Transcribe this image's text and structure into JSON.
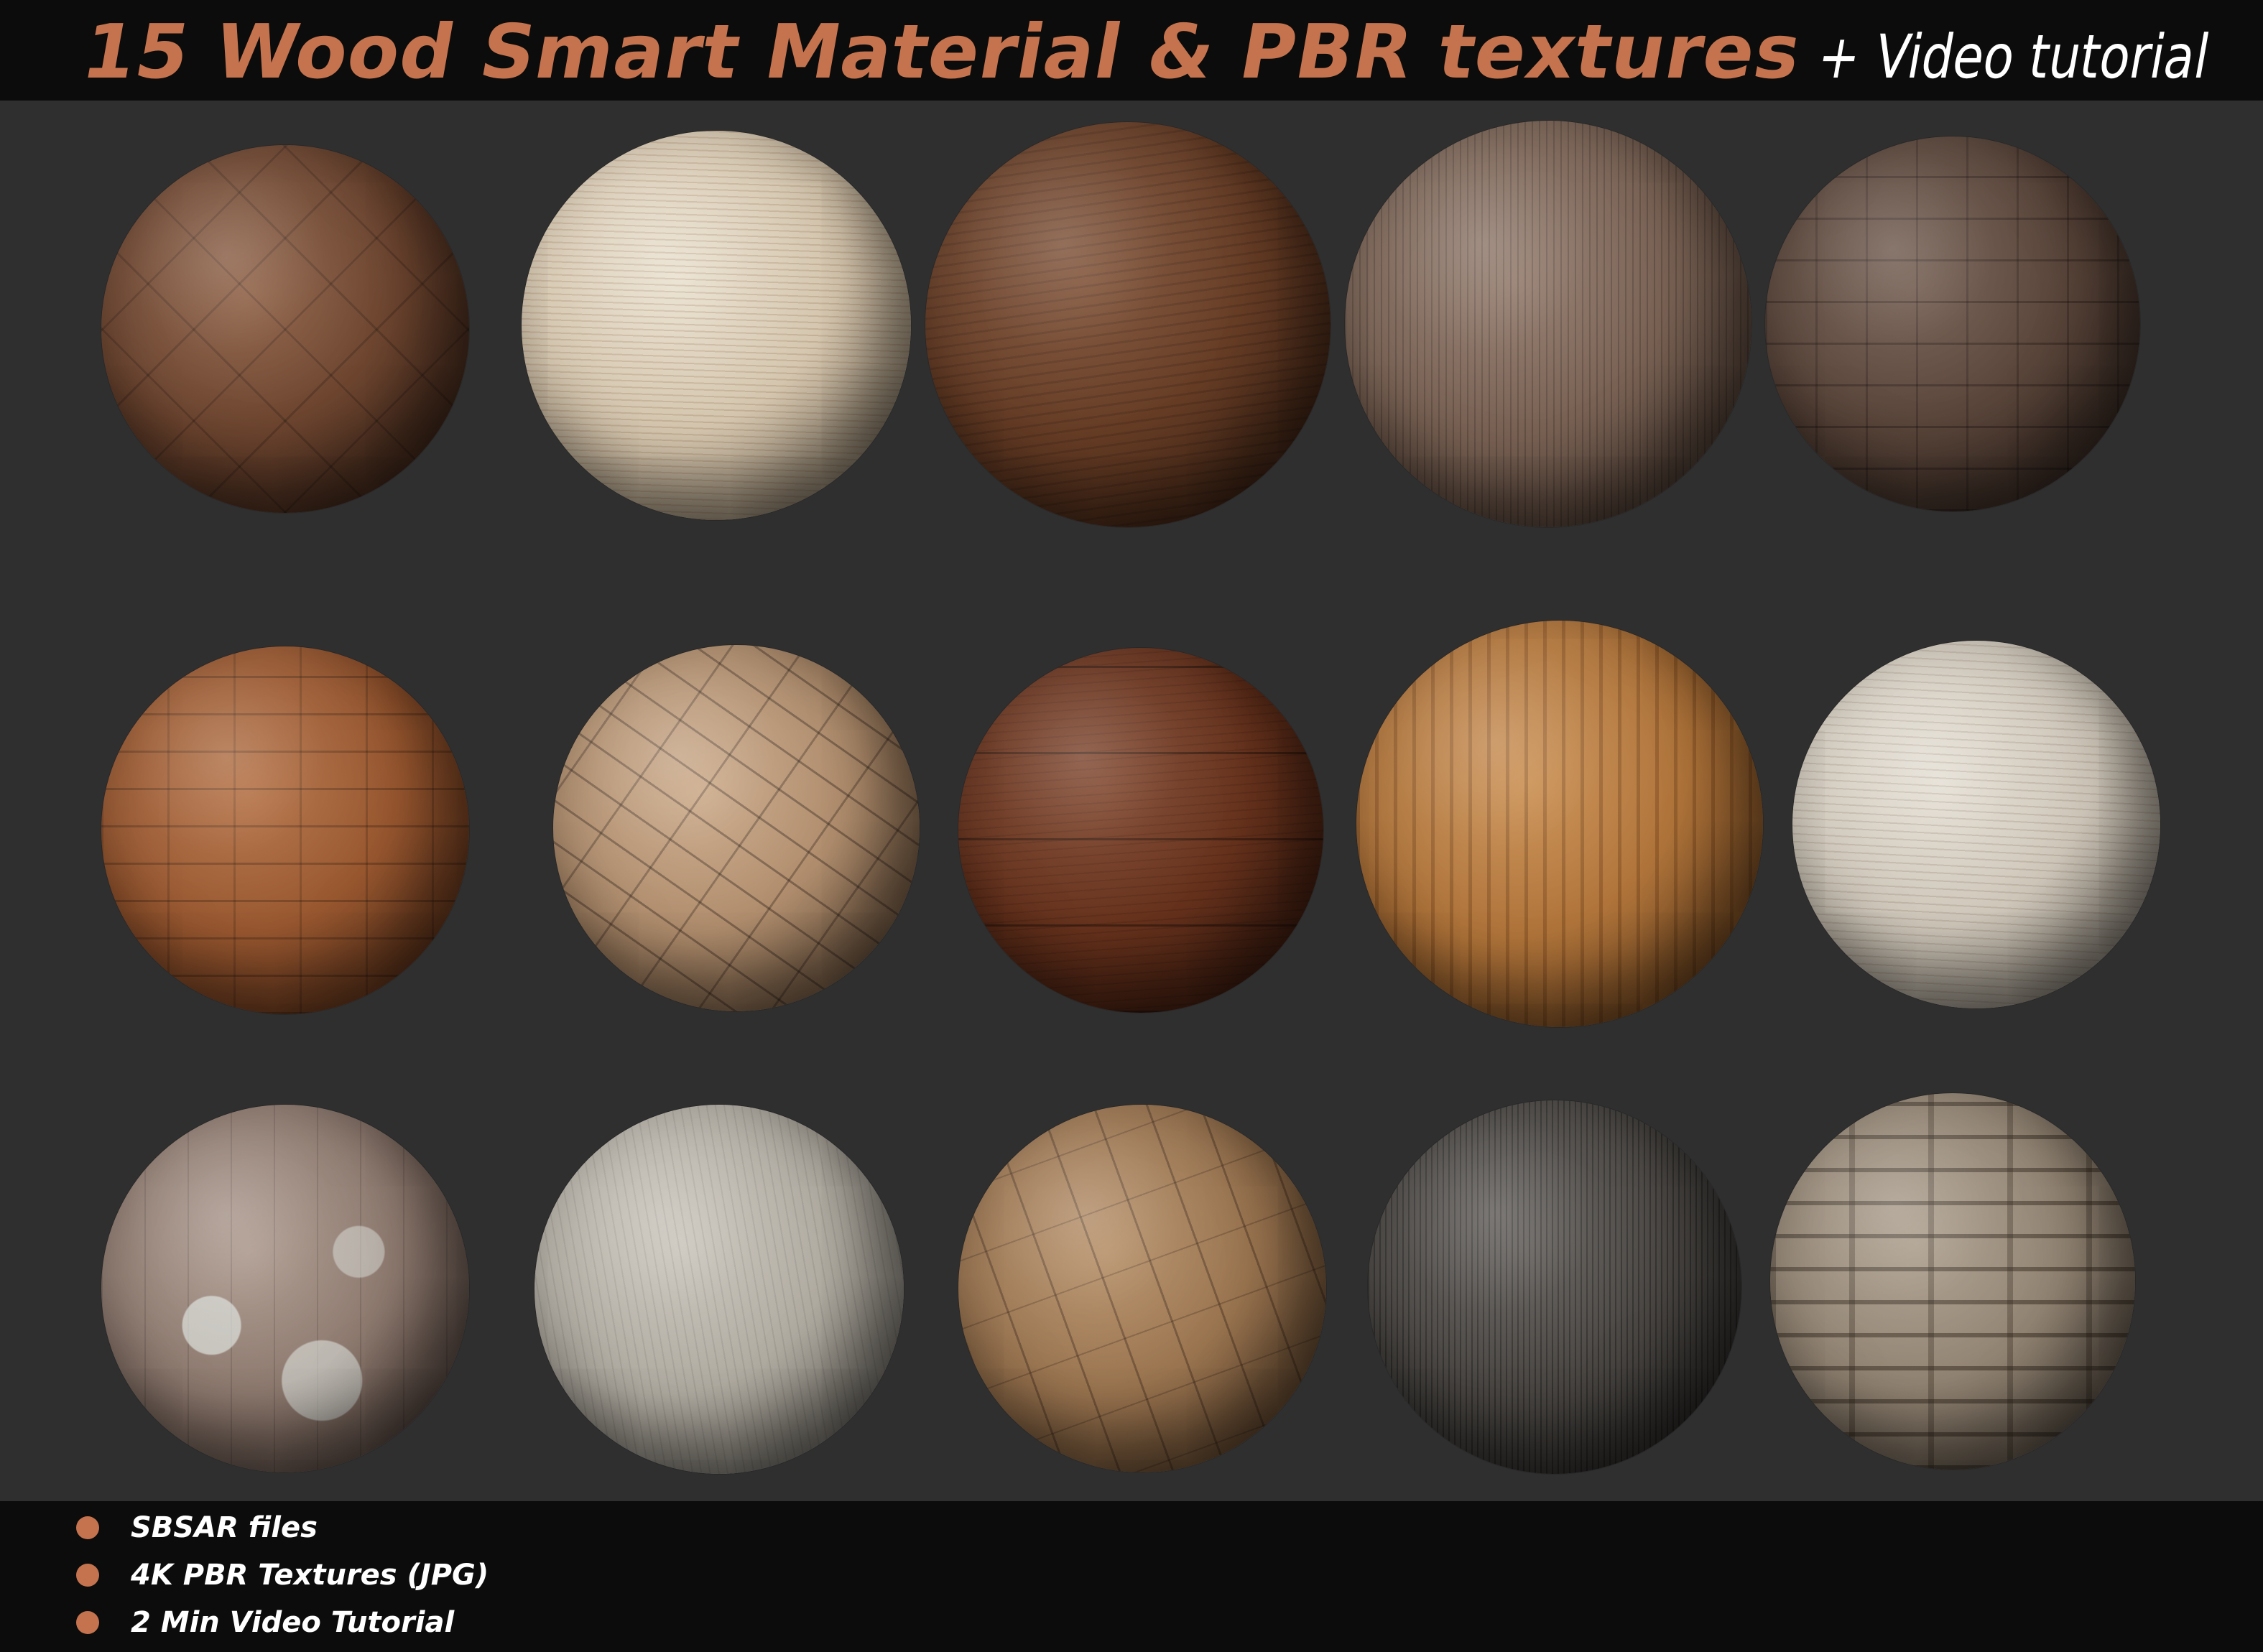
{
  "header": {
    "title": "15 Wood Smart Material & PBR textures",
    "subtitle": "+ Video tutorial"
  },
  "colors": {
    "accent": "#c4734e",
    "background": "#2f2f30",
    "bar": "#0c0c0c",
    "text": "#ffffff"
  },
  "features": [
    "SBSAR files",
    "4K PBR Textures (JPG)",
    "2 Min Video Tutorial"
  ]
}
